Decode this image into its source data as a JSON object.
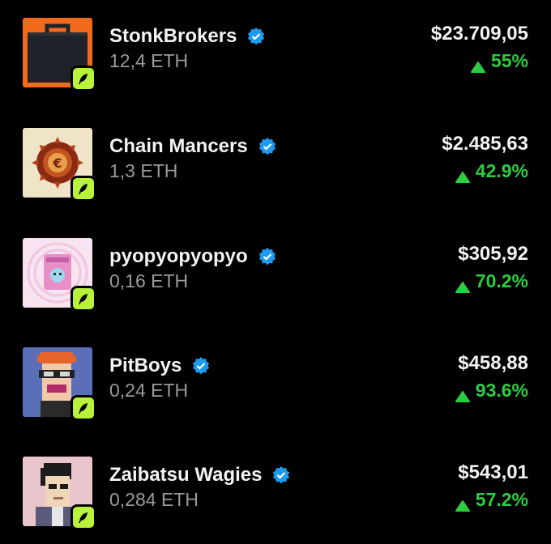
{
  "collections": [
    {
      "name": "StonkBrokers",
      "volume": "12,4 ETH",
      "price": "$23.709,05",
      "change": "55%",
      "thumb_icon": "briefcase-thumbnail"
    },
    {
      "name": "Chain Mancers",
      "volume": "1,3 ETH",
      "price": "$2.485,63",
      "change": "42.9%",
      "thumb_icon": "sun-medallion-thumbnail"
    },
    {
      "name": "pyopyopyopyo",
      "volume": "0,16 ETH",
      "price": "$305,92",
      "change": "70.2%",
      "thumb_icon": "pink-card-thumbnail"
    },
    {
      "name": "PitBoys",
      "volume": "0,24 ETH",
      "price": "$458,88",
      "change": "93.6%",
      "thumb_icon": "pixel-avatar-thumbnail"
    },
    {
      "name": "Zaibatsu Wagies",
      "volume": "0,284 ETH",
      "price": "$543,01",
      "change": "57.2%",
      "thumb_icon": "pixel-portrait-thumbnail"
    }
  ],
  "colors": {
    "background": "#000000",
    "positive": "#2ecc40",
    "verified": "#1d9bf0",
    "badge": "#b9f23a"
  }
}
